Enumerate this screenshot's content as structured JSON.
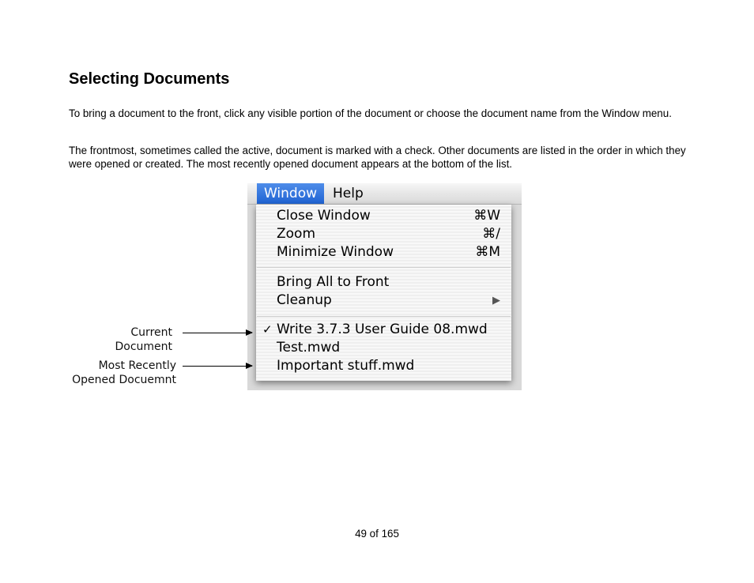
{
  "heading": "Selecting Documents",
  "paragraphs": [
    "To bring a document to the front, click any visible portion of the document or choose the document name from the Window menu.",
    "The frontmost, sometimes called the active, document is marked with a check. Other documents are listed in the order in which they were opened or created. The most recently opened document appears at the bottom of the list."
  ],
  "figure": {
    "menubar": {
      "window": "Window",
      "help": "Help"
    },
    "menu": {
      "close_window": {
        "label": "Close Window",
        "shortcut": "⌘W"
      },
      "zoom": {
        "label": "Zoom",
        "shortcut": "⌘/"
      },
      "minimize_window": {
        "label": "Minimize Window",
        "shortcut": "⌘M"
      },
      "bring_all_to_front": {
        "label": "Bring All to Front"
      },
      "cleanup": {
        "label": "Cleanup",
        "submenu_icon": "▶"
      },
      "documents": [
        {
          "label": "Write 3.7.3 User Guide 08.mwd",
          "checked": true,
          "check": "✓"
        },
        {
          "label": "Test.mwd",
          "checked": false
        },
        {
          "label": "Important stuff.mwd",
          "checked": false
        }
      ]
    },
    "annotations": {
      "current_document": "Current Document",
      "most_recently_line1": "Most Recently",
      "most_recently_line2": "Opened Docuemnt"
    }
  },
  "footer": {
    "page": "49 of 165"
  },
  "colors": {
    "menu_highlight": "#1f63d3",
    "menu_bg": "#f8f8f8"
  }
}
